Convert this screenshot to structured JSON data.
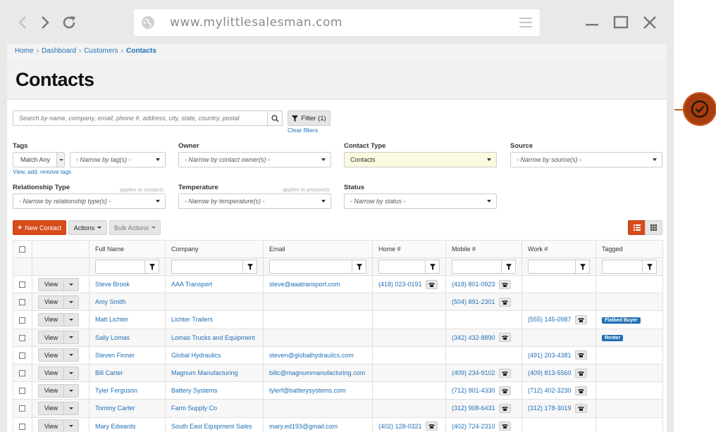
{
  "browser": {
    "url": "www.mylittlesalesman.com",
    "icons": [
      "back-arrow-icon",
      "forward-arrow-icon",
      "reload-icon",
      "globe-icon",
      "hamburger-menu-icon",
      "minimize-icon",
      "maximize-icon",
      "close-icon"
    ]
  },
  "breadcrumb": [
    "Home",
    "Dashboard",
    "Customers",
    "Contacts"
  ],
  "page_title": "Contacts",
  "search": {
    "placeholder": "Search by name, company, email, phone #, address, city, state, country, postal",
    "filter_label": "Filter (1)",
    "clear_filters": "Clear filters"
  },
  "filters": {
    "tags": {
      "label": "Tags",
      "match": "Match Any",
      "value": "- Narrow by tag(s) -",
      "edit_link": "View, add, remove tags"
    },
    "owner": {
      "label": "Owner",
      "value": "- Narrow by contact owner(s) -"
    },
    "contact_type": {
      "label": "Contact Type",
      "value": "Contacts"
    },
    "source": {
      "label": "Source",
      "value": "- Narrow by source(s) -"
    },
    "relationship_type": {
      "label": "Relationship Type",
      "hint": "applies to contacts",
      "value": "- Narrow by relationship type(s) -"
    },
    "temperature": {
      "label": "Temperature",
      "hint": "applies to prospects",
      "value": "- Narrow by temperature(s) -"
    },
    "status": {
      "label": "Status",
      "value": "- Narrow by status -"
    }
  },
  "toolbar": {
    "new_contact": "New Contact",
    "actions": "Actions",
    "bulk_actions": "Bulk Actions"
  },
  "table": {
    "columns": [
      "Full Name",
      "Company",
      "Email",
      "Home #",
      "Mobile #",
      "Work #",
      "Tagged"
    ],
    "view_label": "View",
    "rows": [
      {
        "name": "Steve Brook",
        "company": "AAA Transport",
        "email": "steve@aaatransport.com",
        "home": "(418) 023-0191",
        "mobile": "(418) 801-0923",
        "work": "",
        "tag": ""
      },
      {
        "name": "Amy Smith",
        "company": "",
        "email": "",
        "home": "",
        "mobile": "(504) 891-2301",
        "work": "",
        "tag": ""
      },
      {
        "name": "Matt Lichter",
        "company": "Lichter Trailers",
        "email": "",
        "home": "",
        "mobile": "",
        "work": "(555) 145-0987",
        "tag": "Flatbed Buyer"
      },
      {
        "name": "Sally Lomas",
        "company": "Lomas Trucks and Equipment",
        "email": "",
        "home": "",
        "mobile": "(342) 432-8890",
        "work": "",
        "tag": "Renter"
      },
      {
        "name": "Steven Finner",
        "company": "Global Hydraulics",
        "email": "steven@globalhydraulics.com",
        "home": "",
        "mobile": "",
        "work": "(491) 203-4381",
        "tag": ""
      },
      {
        "name": "Bill Carter",
        "company": "Magnum Manufacturing",
        "email": "billc@magnummanufacturing.com",
        "home": "",
        "mobile": "(409) 234-9102",
        "work": "(409) 813-5560",
        "tag": ""
      },
      {
        "name": "Tyler Ferguson",
        "company": "Battery Systems",
        "email": "tylerf@batterysystems.com",
        "home": "",
        "mobile": "(712) 901-4330",
        "work": "(712) 402-3230",
        "tag": ""
      },
      {
        "name": "Tommy Carter",
        "company": "Farm Supply Co",
        "email": "",
        "home": "",
        "mobile": "(312) 908-6431",
        "work": "(312) 178-3019",
        "tag": ""
      },
      {
        "name": "Mary Edwards",
        "company": "South East Equipment Sales",
        "email": "mary.ed193@gmail.com",
        "home": "(402) 128-0321",
        "mobile": "(402) 724-2310",
        "work": "",
        "tag": ""
      }
    ]
  },
  "colors": {
    "accent": "#d84c1c",
    "link": "#1f6fb5",
    "badge": "#a63e10",
    "active_filter": "#fbf9df"
  }
}
